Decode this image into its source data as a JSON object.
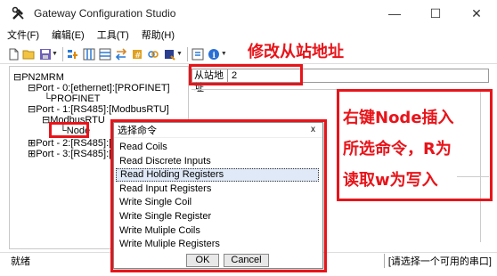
{
  "window": {
    "title": "Gateway Configuration Studio",
    "controls": {
      "minimize": "—",
      "maximize": "☐",
      "close": "✕"
    }
  },
  "menu": [
    {
      "label": "文件(F)"
    },
    {
      "label": "编辑(E)"
    },
    {
      "label": "工具(T)"
    },
    {
      "label": "帮助(H)"
    }
  ],
  "toolbar": {
    "icons": [
      "new-file-icon",
      "open-folder-icon",
      "save-icon",
      "add-icon",
      "columns-icon",
      "grid-icon",
      "transfer-icon",
      "compile-icon",
      "link-icon",
      "block-icon",
      "dropdown-arrow",
      "tools-icon",
      "info-icon"
    ]
  },
  "tree": {
    "root": "PN2MRM",
    "port0": "Port - 0:[ethernet]:[PROFINET]",
    "profinet": "PROFINET",
    "port1": "Port - 1:[RS485]:[ModbusRTU]",
    "modbusrtu": "ModbusRTU",
    "node": "Node",
    "port2": "Port - 2:[RS485]:[",
    "port3": "Port - 3:[RS485]:["
  },
  "properties": {
    "label": "从站地址",
    "value": "2"
  },
  "dialog": {
    "title": "选择命令",
    "close": "x",
    "commands": [
      "Read Coils",
      "Read Discrete Inputs",
      "Read Holding Registers",
      "Read Input Registers",
      "Write Single Coil",
      "Write Single Register",
      "Write Muliple Coils",
      "Write Muliple Registers"
    ],
    "selected_index": 2,
    "ok": "OK",
    "cancel": "Cancel"
  },
  "status": {
    "left": "就绪",
    "right": "[请选择一个可用的串口]"
  },
  "annotations": {
    "modify_address": "修改从站地址",
    "line1": "右键Node插入",
    "line2": "所选命令，R为",
    "line3": "读取w为写入"
  },
  "colors": {
    "annotation_red": "#e8141a",
    "selection": "#dfe9f7"
  }
}
